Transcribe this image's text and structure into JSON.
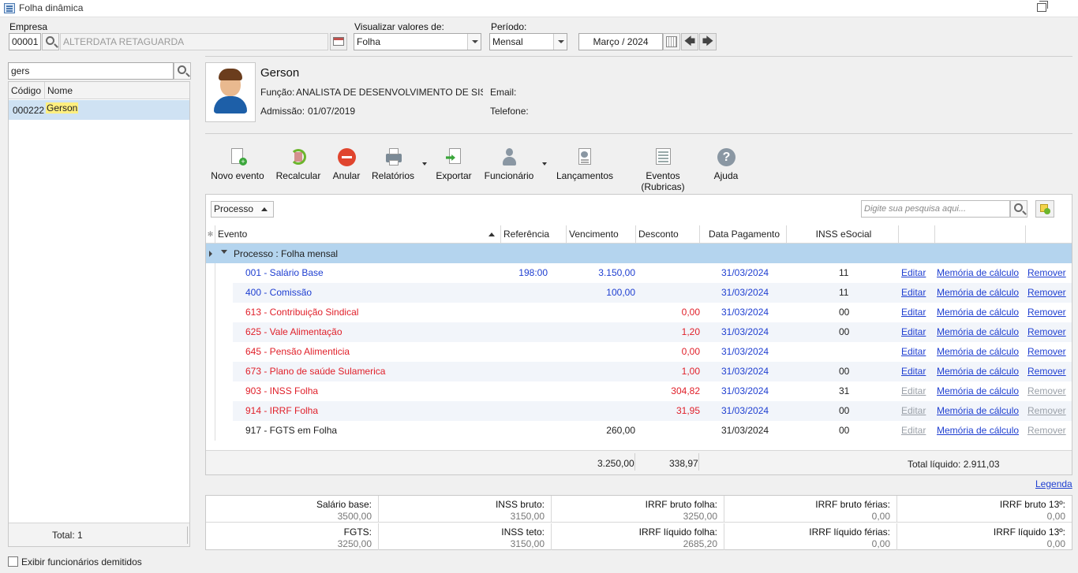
{
  "window": {
    "title": "Folha dinâmica"
  },
  "filters": {
    "empresa_label": "Empresa",
    "empresa_code": "00001",
    "empresa_name": "ALTERDATA RETAGUARDA",
    "visualizar_label": "Visualizar valores de:",
    "visualizar_value": "Folha",
    "periodo_label": "Período:",
    "periodo_value": "Mensal",
    "month_value": "Março / 2024"
  },
  "employee_search": {
    "query": "gers",
    "columns": [
      "Código",
      "Nome"
    ],
    "results": [
      {
        "code": "000222",
        "name": "Gerson"
      }
    ],
    "total": "Total: 1",
    "show_dismissed_label": "Exibir funcionários demitidos"
  },
  "employee": {
    "name": "Gerson",
    "funcao_label": "Função:",
    "funcao": "ANALISTA DE DESENVOLVIMENTO DE SISTEM.",
    "admissao_label": "Admissão:",
    "admissao": "01/07/2019",
    "email_label": "Email:",
    "telefone_label": "Telefone:"
  },
  "toolbar": {
    "novo_evento": "Novo evento",
    "recalcular": "Recalcular",
    "anular": "Anular",
    "relatorios": "Relatórios",
    "exportar": "Exportar",
    "funcionario": "Funcionário",
    "lancamentos": "Lançamentos",
    "eventos": "Eventos (Rubricas)",
    "ajuda": "Ajuda"
  },
  "grid": {
    "group_by": "Processo",
    "search_placeholder": "Digite sua pesquisa aqui...",
    "columns": {
      "evento": "Evento",
      "referencia": "Referência",
      "vencimento": "Vencimento",
      "desconto": "Desconto",
      "data_pagamento": "Data Pagamento",
      "inss": "INSS eSocial"
    },
    "group_label": "Processo : Folha mensal",
    "actions": {
      "edit": "Editar",
      "memory": "Memória de cálculo",
      "remove": "Remover"
    },
    "rows": [
      {
        "evento": "001 - Salário Base",
        "ref": "198:00",
        "venc": "3.150,00",
        "desc": "",
        "data": "31/03/2024",
        "inss": "11",
        "color": "blue",
        "edit_enabled": true,
        "remove_enabled": true
      },
      {
        "evento": "400 - Comissão",
        "ref": "",
        "venc": "100,00",
        "desc": "",
        "data": "31/03/2024",
        "inss": "11",
        "color": "blue",
        "edit_enabled": true,
        "remove_enabled": true
      },
      {
        "evento": "613 - Contribuição Sindical",
        "ref": "",
        "venc": "",
        "desc": "0,00",
        "data": "31/03/2024",
        "inss": "00",
        "color": "red",
        "edit_enabled": true,
        "remove_enabled": true
      },
      {
        "evento": "625 - Vale Alimentação",
        "ref": "",
        "venc": "",
        "desc": "1,20",
        "data": "31/03/2024",
        "inss": "00",
        "color": "red",
        "edit_enabled": true,
        "remove_enabled": true
      },
      {
        "evento": "645 - Pensão Alimenticia",
        "ref": "",
        "venc": "",
        "desc": "0,00",
        "data": "31/03/2024",
        "inss": "",
        "color": "red",
        "edit_enabled": true,
        "remove_enabled": true
      },
      {
        "evento": "673 - Plano de saúde Sulamerica",
        "ref": "",
        "venc": "",
        "desc": "1,00",
        "data": "31/03/2024",
        "inss": "00",
        "color": "red",
        "edit_enabled": true,
        "remove_enabled": true
      },
      {
        "evento": "903 - INSS Folha",
        "ref": "",
        "venc": "",
        "desc": "304,82",
        "data": "31/03/2024",
        "inss": "31",
        "color": "red",
        "edit_enabled": false,
        "remove_enabled": false
      },
      {
        "evento": "914 - IRRF Folha",
        "ref": "",
        "venc": "",
        "desc": "31,95",
        "data": "31/03/2024",
        "inss": "00",
        "color": "red",
        "edit_enabled": false,
        "remove_enabled": false
      },
      {
        "evento": "917 - FGTS em Folha",
        "ref": "",
        "venc": "260,00",
        "desc": "",
        "data": "31/03/2024",
        "inss": "00",
        "color": "blk",
        "edit_enabled": false,
        "remove_enabled": false
      }
    ],
    "total_venc": "3.250,00",
    "total_desc": "338,97",
    "total_liquido": "Total líquido: 2.911,03",
    "legenda": "Legenda"
  },
  "summary": [
    {
      "k": "Salário base:",
      "v": "3500,00"
    },
    {
      "k": "INSS bruto:",
      "v": "3150,00"
    },
    {
      "k": "IRRF bruto folha:",
      "v": "3250,00"
    },
    {
      "k": "IRRF bruto férias:",
      "v": "0,00"
    },
    {
      "k": "IRRF bruto 13º:",
      "v": "0,00"
    },
    {
      "k": "FGTS:",
      "v": "3250,00"
    },
    {
      "k": "INSS teto:",
      "v": "3150,00"
    },
    {
      "k": "IRRF líquido folha:",
      "v": "2685,20"
    },
    {
      "k": "IRRF líquido férias:",
      "v": "0,00"
    },
    {
      "k": "IRRF líquido 13º:",
      "v": "0,00"
    }
  ],
  "colors": {
    "accent": "#1f3fd1",
    "negative": "#e0202a",
    "group_row": "#b4d4ee",
    "selection": "#cfe2f3"
  }
}
